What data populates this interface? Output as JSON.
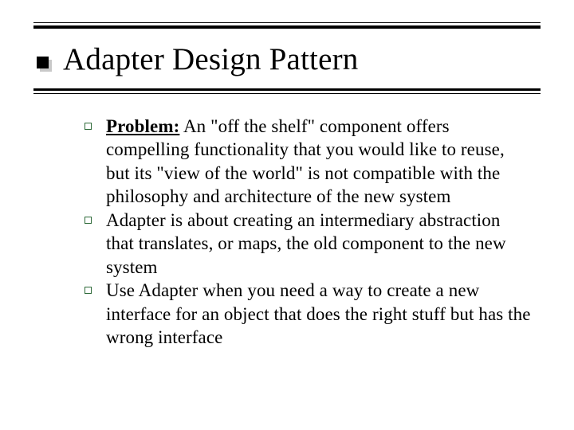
{
  "slide": {
    "title": "Adapter Design Pattern",
    "bullets": [
      {
        "label": "Problem:",
        "text": " An \"off the shelf\" component offers compelling functionality that you would like to reuse, but its \"view of the world\" is not compatible with the philosophy and architecture of the new system"
      },
      {
        "label": "",
        "text": "Adapter is about creating an intermediary abstraction that translates, or maps, the old component to the new system"
      },
      {
        "label": "",
        "text": "Use Adapter when you need a way to create a new interface for an object that does the right stuff but has the wrong interface"
      }
    ]
  }
}
